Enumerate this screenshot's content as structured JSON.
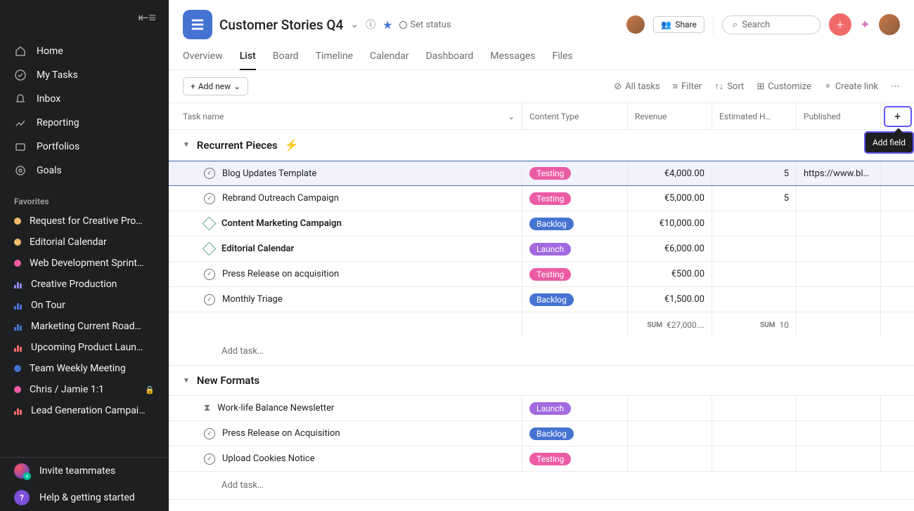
{
  "sidebar": {
    "nav": [
      {
        "label": "Home",
        "icon": "home"
      },
      {
        "label": "My Tasks",
        "icon": "check"
      },
      {
        "label": "Inbox",
        "icon": "bell"
      },
      {
        "label": "Reporting",
        "icon": "chart"
      },
      {
        "label": "Portfolios",
        "icon": "folder"
      },
      {
        "label": "Goals",
        "icon": "target"
      }
    ],
    "favorites_title": "Favorites",
    "favorites": [
      {
        "label": "Request for Creative Pro…",
        "color": "#f1bd6c",
        "type": "dot"
      },
      {
        "label": "Editorial Calendar",
        "color": "#f1bd6c",
        "type": "dot"
      },
      {
        "label": "Web Development Sprint…",
        "color": "#ec5ca5",
        "type": "dot"
      },
      {
        "label": "Creative Production",
        "color": "#8d84e8",
        "type": "bars"
      },
      {
        "label": "On Tour",
        "color": "#4573d2",
        "type": "bars"
      },
      {
        "label": "Marketing Current Road…",
        "color": "#4573d2",
        "type": "bars"
      },
      {
        "label": "Upcoming Product Laun…",
        "color": "#f06a6a",
        "type": "bars"
      },
      {
        "label": "Team Weekly Meeting",
        "color": "#4573d2",
        "type": "dot"
      },
      {
        "label": "Chris / Jamie 1:1",
        "color": "#ec5ca5",
        "type": "dot",
        "locked": true
      },
      {
        "label": "Lead Generation Campai…",
        "color": "#f06a6a",
        "type": "bars"
      }
    ],
    "invite": "Invite teammates",
    "help": "Help & getting started"
  },
  "header": {
    "title": "Customer Stories Q4",
    "set_status": "Set status",
    "share": "Share",
    "search_placeholder": "Search"
  },
  "tabs": [
    "Overview",
    "List",
    "Board",
    "Timeline",
    "Calendar",
    "Dashboard",
    "Messages",
    "Files"
  ],
  "active_tab": "List",
  "toolbar": {
    "add_new": "Add new",
    "all_tasks": "All tasks",
    "filter": "Filter",
    "sort": "Sort",
    "customize": "Customize",
    "create_link": "Create link"
  },
  "columns": {
    "task": "Task name",
    "content_type": "Content Type",
    "revenue": "Revenue",
    "estimated": "Estimated H…",
    "published": "Published",
    "add_field_tooltip": "Add field"
  },
  "add_task_placeholder": "Add task…",
  "sections": [
    {
      "title": "Recurrent Pieces",
      "bolt": true,
      "rows": [
        {
          "name": "Blog Updates Template",
          "icon": "circle",
          "selected": true,
          "content_type": {
            "label": "Testing",
            "color": "pink"
          },
          "revenue": "€4,000.00",
          "estimated": "5",
          "published": "https://www.blo…"
        },
        {
          "name": "Rebrand Outreach Campaign",
          "icon": "circle",
          "content_type": {
            "label": "Testing",
            "color": "pink"
          },
          "revenue": "€5,000.00",
          "estimated": "5",
          "published": ""
        },
        {
          "name": "Content Marketing Campaign",
          "icon": "poly",
          "bold": true,
          "content_type": {
            "label": "Backlog",
            "color": "blue"
          },
          "revenue": "€10,000.00",
          "estimated": "",
          "published": ""
        },
        {
          "name": "Editorial Calendar",
          "icon": "poly",
          "bold": true,
          "content_type": {
            "label": "Launch",
            "color": "purple"
          },
          "revenue": "€6,000.00",
          "estimated": "",
          "published": ""
        },
        {
          "name": "Press Release on acquisition",
          "icon": "circle",
          "content_type": {
            "label": "Testing",
            "color": "pink"
          },
          "revenue": "€500.00",
          "estimated": "",
          "published": ""
        },
        {
          "name": "Monthly Triage",
          "icon": "circle",
          "content_type": {
            "label": "Backlog",
            "color": "blue"
          },
          "revenue": "€1,500.00",
          "estimated": "",
          "published": ""
        }
      ],
      "sum": {
        "revenue_label": "SUM",
        "revenue": "€27,000.…",
        "estimated_label": "SUM",
        "estimated": "10"
      }
    },
    {
      "title": "New Formats",
      "bolt": false,
      "rows": [
        {
          "name": "Work-life Balance Newsletter",
          "icon": "hourglass",
          "content_type": {
            "label": "Launch",
            "color": "purple"
          },
          "revenue": "",
          "estimated": "",
          "published": ""
        },
        {
          "name": "Press Release on Acquisition",
          "icon": "circle",
          "content_type": {
            "label": "Backlog",
            "color": "blue"
          },
          "revenue": "",
          "estimated": "",
          "published": ""
        },
        {
          "name": "Upload Cookies Notice",
          "icon": "circle",
          "content_type": {
            "label": "Testing",
            "color": "pink"
          },
          "revenue": "",
          "estimated": "",
          "published": ""
        }
      ]
    }
  ]
}
